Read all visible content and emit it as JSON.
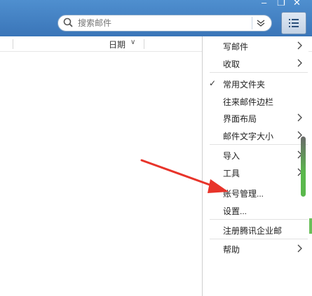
{
  "search": {
    "placeholder": "搜索邮件"
  },
  "header": {
    "date_label": "日期"
  },
  "menu": {
    "items": [
      {
        "label": "写邮件",
        "submenu": true
      },
      {
        "label": "收取",
        "submenu": true
      },
      {
        "label": "常用文件夹",
        "checked": true
      },
      {
        "label": "往来邮件边栏"
      },
      {
        "label": "界面布局",
        "submenu": true
      },
      {
        "label": "邮件文字大小",
        "submenu": true
      },
      {
        "label": "导入",
        "submenu": true
      },
      {
        "label": "工具",
        "submenu": true
      },
      {
        "label": "账号管理..."
      },
      {
        "label": "设置..."
      },
      {
        "label": "注册腾讯企业邮"
      },
      {
        "label": "帮助",
        "submenu": true
      }
    ]
  },
  "colors": {
    "titlebar": "#3f7fc2",
    "annotation_arrow": "#e8342a",
    "scroll_accent": "#5ab84c"
  },
  "icons": [
    "search-icon",
    "chevron-down-icon",
    "double-chevron-down-icon",
    "list-menu-icon",
    "chevron-right-icon",
    "checkmark-icon"
  ]
}
